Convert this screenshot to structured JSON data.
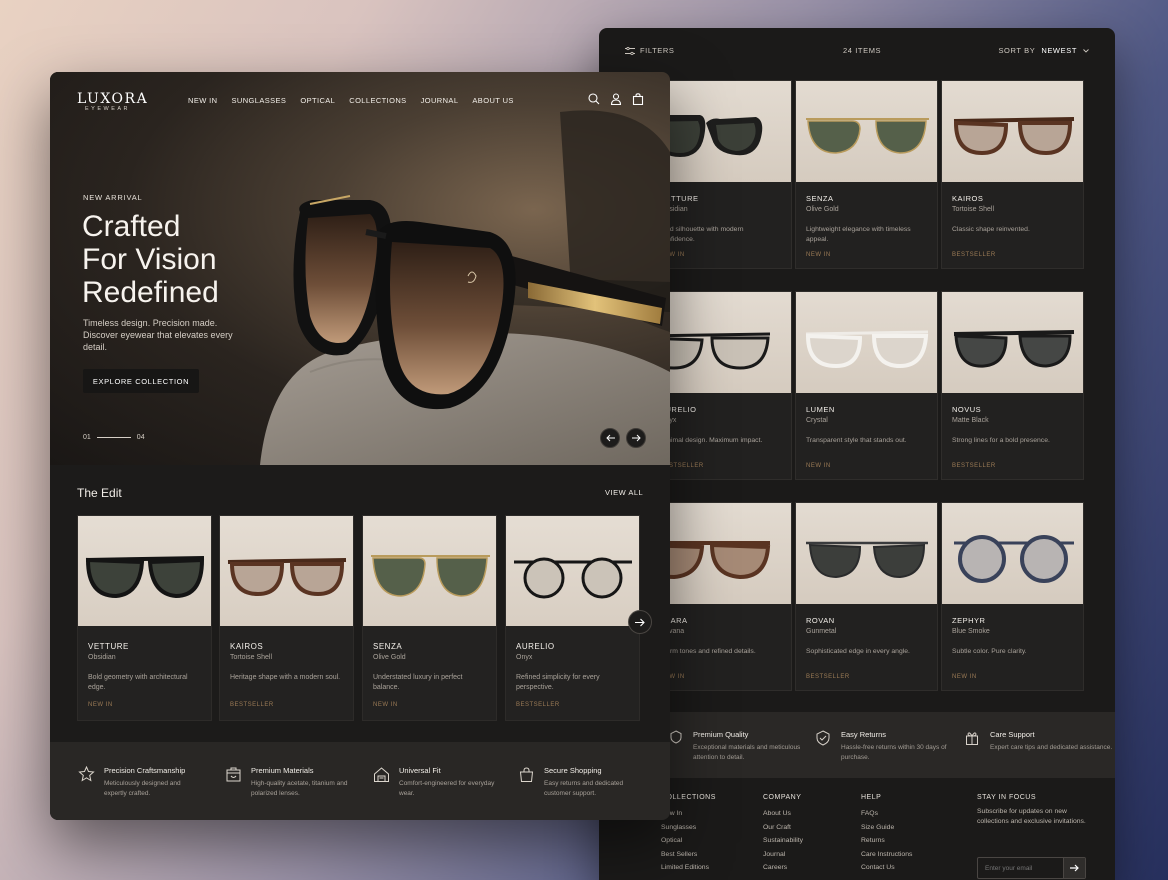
{
  "back": {
    "toolbar": {
      "filters": "FILTERS",
      "count": "24 ITEMS",
      "sort_label": "SORT BY",
      "sort_value": "NEWEST"
    },
    "grid": [
      {
        "name": "VETTURE",
        "material": "Obsidian",
        "desc": "Bold silhouette with modern confidence.",
        "badge": "NEW IN"
      },
      {
        "name": "SENZA",
        "material": "Olive Gold",
        "desc": "Lightweight elegance with timeless appeal.",
        "badge": "NEW IN"
      },
      {
        "name": "KAIROS",
        "material": "Tortoise Shell",
        "desc": "Classic shape reinvented.",
        "badge": "BESTSELLER"
      },
      {
        "name": "AURELIO",
        "material": "Onyx",
        "desc": "Minimal design. Maximum impact.",
        "badge": "BESTSELLER"
      },
      {
        "name": "LUMEN",
        "material": "Crystal",
        "desc": "Transparent style that stands out.",
        "badge": "NEW IN"
      },
      {
        "name": "NOVUS",
        "material": "Matte Black",
        "desc": "Strong lines for a bold presence.",
        "badge": "BESTSELLER"
      },
      {
        "name": "CLARA",
        "material": "Havana",
        "desc": "Warm tones and refined details.",
        "badge": "NEW IN"
      },
      {
        "name": "ROVAN",
        "material": "Gunmetal",
        "desc": "Sophisticated edge in every angle.",
        "badge": "BESTSELLER"
      },
      {
        "name": "ZEPHYR",
        "material": "Blue Smoke",
        "desc": "Subtle color. Pure clarity.",
        "badge": "NEW IN"
      }
    ],
    "benefits": [
      {
        "title": "Premium Quality",
        "desc": "Exceptional materials and meticulous attention to detail."
      },
      {
        "title": "Easy Returns",
        "desc": "Hassle-free returns within 30 days of purchase."
      },
      {
        "title": "Care Support",
        "desc": "Expert care tips and dedicated assistance."
      }
    ],
    "footer": {
      "collections": {
        "title": "COLLECTIONS",
        "links": [
          "New In",
          "Sunglasses",
          "Optical",
          "Best Sellers",
          "Limited Editions"
        ]
      },
      "company": {
        "title": "COMPANY",
        "links": [
          "About Us",
          "Our Craft",
          "Sustainability",
          "Journal",
          "Careers"
        ]
      },
      "help": {
        "title": "HELP",
        "links": [
          "FAQs",
          "Size Guide",
          "Returns",
          "Care Instructions",
          "Contact Us"
        ]
      },
      "subscribe": {
        "title": "STAY IN FOCUS",
        "text": "Subscribe for updates on new collections and exclusive invitations.",
        "placeholder": "Enter your email"
      }
    }
  },
  "front": {
    "logo": {
      "name": "LUXORA",
      "sub": "EYEWEAR"
    },
    "menu": [
      "NEW IN",
      "SUNGLASSES",
      "OPTICAL",
      "COLLECTIONS",
      "JOURNAL",
      "ABOUT US"
    ],
    "hero": {
      "eyebrow": "NEW ARRIVAL",
      "headline_1": "Crafted",
      "headline_2": "For Vision",
      "headline_3": "Redefined",
      "subcopy": "Timeless design. Precision made. Discover eyewear that elevates every detail.",
      "cta": "EXPLORE COLLECTION",
      "slide_current": "01",
      "slide_total": "04"
    },
    "edit": {
      "title": "The Edit",
      "view_all": "VIEW ALL",
      "cards": [
        {
          "name": "VETTURE",
          "material": "Obsidian",
          "desc": "Bold geometry with architectural edge.",
          "badge": "NEW IN"
        },
        {
          "name": "KAIROS",
          "material": "Tortoise Shell",
          "desc": "Heritage shape with a modern soul.",
          "badge": "BESTSELLER"
        },
        {
          "name": "SENZA",
          "material": "Olive Gold",
          "desc": "Understated luxury in perfect balance.",
          "badge": "NEW IN"
        },
        {
          "name": "AURELIO",
          "material": "Onyx",
          "desc": "Refined simplicity for every perspective.",
          "badge": "BESTSELLER"
        }
      ]
    },
    "benefits": [
      {
        "title": "Precision Craftsmanship",
        "desc": "Meticulously designed and expertly crafted."
      },
      {
        "title": "Premium Materials",
        "desc": "High-quality acetate, titanium and polarized lenses."
      },
      {
        "title": "Universal Fit",
        "desc": "Comfort-engineered for everyday wear."
      },
      {
        "title": "Secure Shopping",
        "desc": "Easy returns and dedicated customer support."
      }
    ]
  },
  "colors": {
    "accent_badge": "#9a7a55",
    "panel": "#1c1b1a",
    "card": "#232221"
  }
}
